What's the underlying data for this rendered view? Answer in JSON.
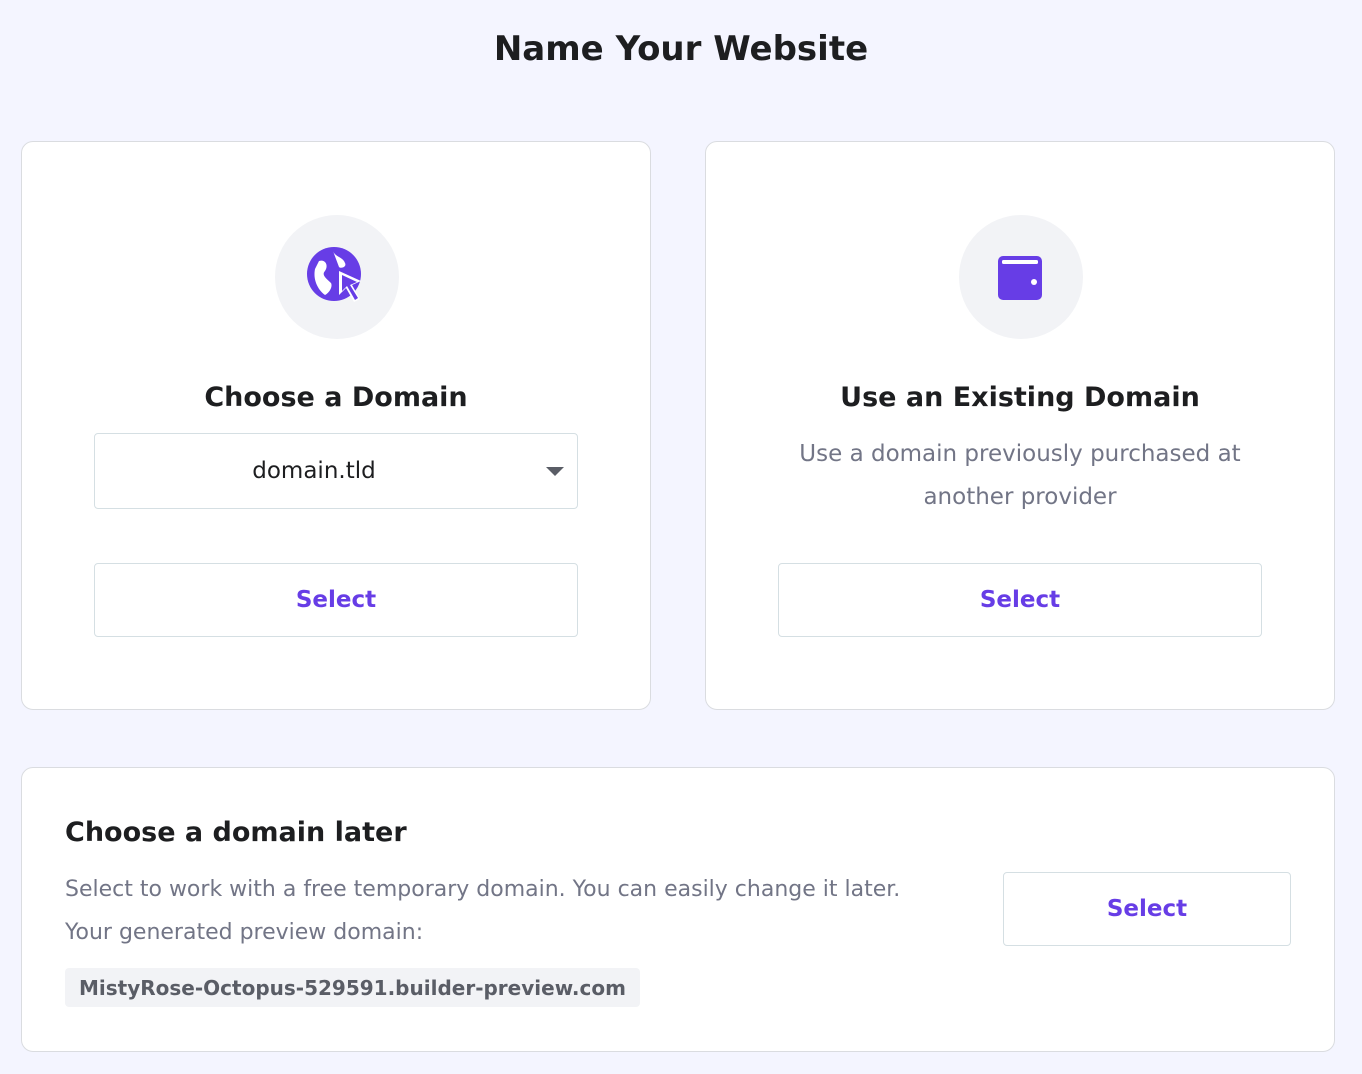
{
  "header": {
    "title": "Name Your Website"
  },
  "choose_domain": {
    "icon": "globe-cursor-icon",
    "title": "Choose a Domain",
    "dropdown_value": "domain.tld",
    "select_label": "Select"
  },
  "existing_domain": {
    "icon": "wallet-icon",
    "title": "Use an Existing Domain",
    "description_line1": "Use a domain previously purchased at",
    "description_line2": "another provider",
    "select_label": "Select"
  },
  "domain_later": {
    "title": "Choose a domain later",
    "description_line1": "Select to work with a free temporary domain. You can easily change it later.",
    "description_line2": "Your generated preview domain:",
    "preview_domain": "MistyRose-Octopus-529591.builder-preview.com",
    "select_label": "Select"
  },
  "colors": {
    "accent": "#673de6",
    "background": "#f4f5ff",
    "muted_text": "#727586"
  }
}
